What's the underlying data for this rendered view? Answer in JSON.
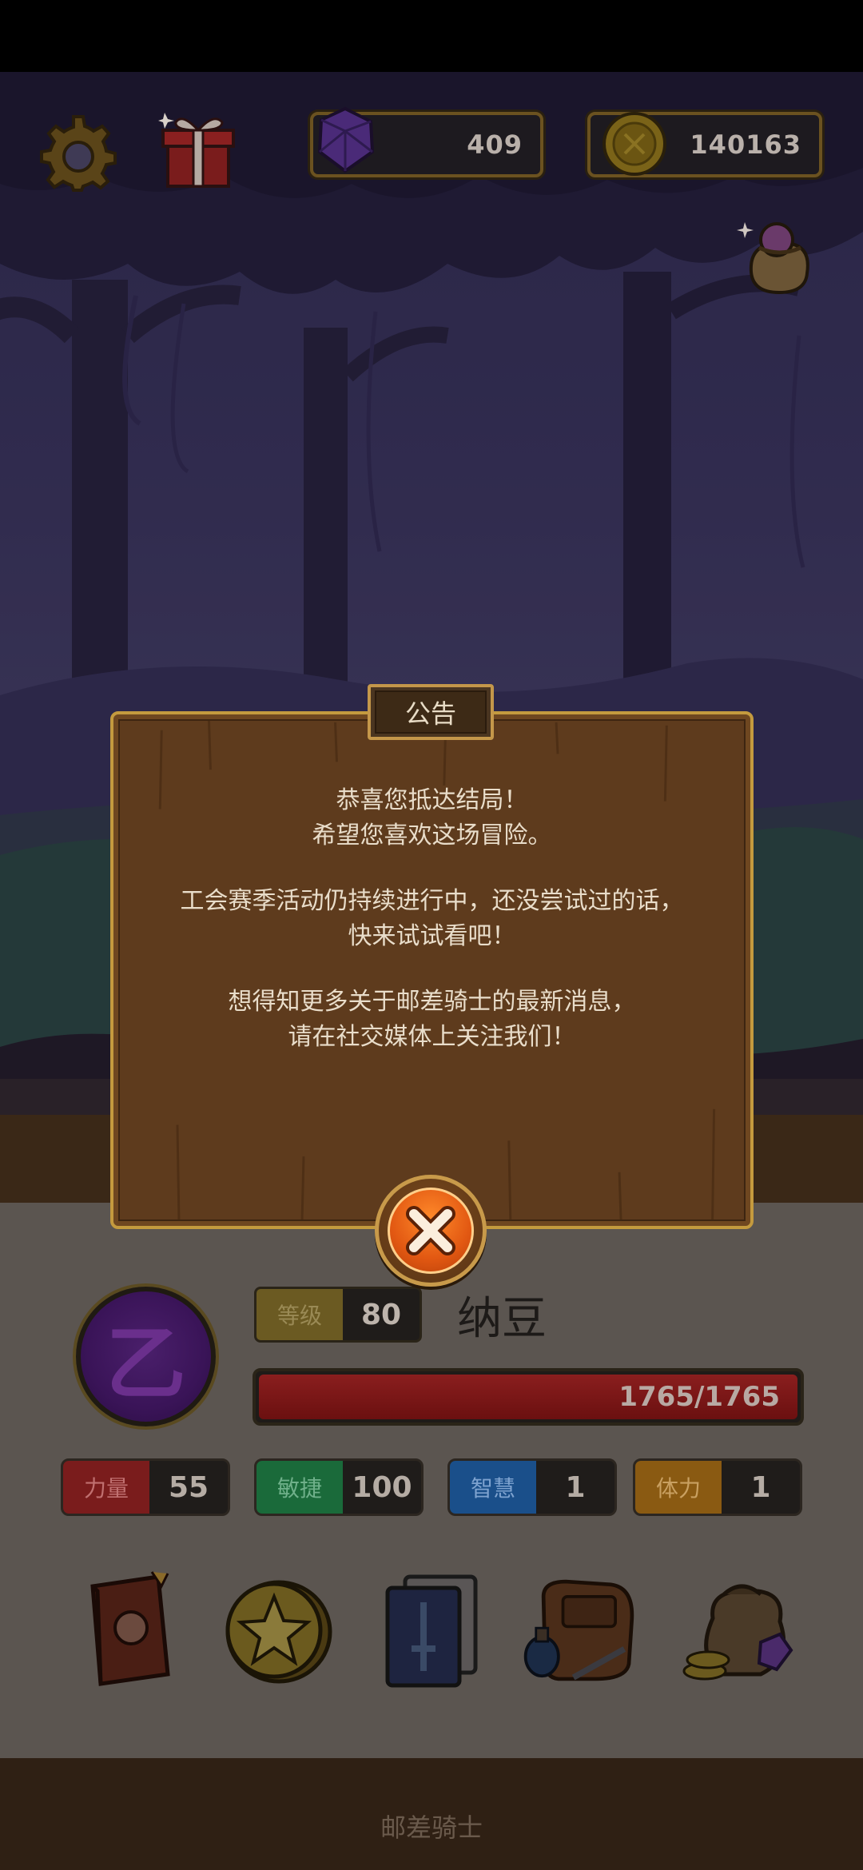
{
  "hud": {
    "gems": "409",
    "coins": "140163",
    "settings_icon": "gear-icon",
    "gift_icon": "gift-box-icon",
    "gem_icon": "purple-gem-icon",
    "coin_icon": "gold-coin-icon",
    "bag_icon": "loot-bag-icon"
  },
  "dialog": {
    "title": "公告",
    "lines_1": [
      "恭喜您抵达结局！",
      "希望您喜欢这场冒险。"
    ],
    "lines_2": [
      "工会赛季活动仍持续进行中，还没尝试过的话，",
      "快来试试看吧！"
    ],
    "lines_3": [
      "想得知更多关于邮差骑士的最新消息，",
      "请在社交媒体上关注我们！"
    ],
    "close_icon": "close-x-icon"
  },
  "player": {
    "emblem_letter": "乙",
    "level_label": "等级",
    "level": "80",
    "name": "纳豆",
    "hp": "1765/1765",
    "hp_fraction": 1.0
  },
  "stats": [
    {
      "label": "力量",
      "value": "55",
      "color": "#7a1c1c",
      "text_color": "#c07070"
    },
    {
      "label": "敏捷",
      "value": "100",
      "color": "#1a6a3a",
      "text_color": "#6fb08a"
    },
    {
      "label": "智慧",
      "value": "1",
      "color": "#1a4f8a",
      "text_color": "#7ea3d0"
    },
    {
      "label": "体力",
      "value": "1",
      "color": "#8a5a12",
      "text_color": "#c9a061"
    }
  ],
  "menu": [
    {
      "icon": "skill-book-icon"
    },
    {
      "icon": "star-coin-icon"
    },
    {
      "icon": "sword-card-icon"
    },
    {
      "icon": "backpack-potion-icon"
    },
    {
      "icon": "treasure-sack-icon"
    }
  ],
  "footer": {
    "label": "邮差骑士"
  },
  "colors": {
    "dialog_wood": "#5e3b1d",
    "dialog_border": "#c49a3e",
    "close_orange": "#e25812",
    "hp_red": "#8a1e1e"
  }
}
